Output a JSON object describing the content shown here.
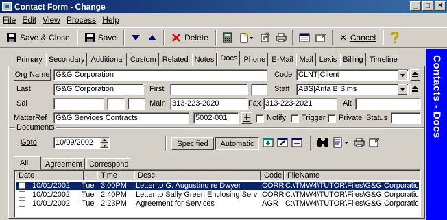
{
  "window": {
    "title": "Contact Form - Change"
  },
  "menu": [
    "File",
    "Edit",
    "View",
    "Process",
    "Help"
  ],
  "toolbar": {
    "save_close": "Save & Close",
    "save": "Save",
    "delete": "Delete",
    "cancel": "Cancel"
  },
  "tabs": [
    "Primary",
    "Secondary",
    "Additional",
    "Custom",
    "Related",
    "Notes",
    "Docs",
    "Phone",
    "E-Mail",
    "Mail",
    "Lexis",
    "Billing",
    "Timeline"
  ],
  "active_tab": "Docs",
  "banner": "Contacts - Docs",
  "form": {
    "org_name_label": "Org Name",
    "org_name": "G&G Corporation",
    "code_label": "Code",
    "code": "CLNT|Client",
    "last_label": "Last",
    "last": "G&G Corporation",
    "first_label": "First",
    "first": "",
    "staff_label": "Staff",
    "staff": "ABS|Arita B Sims",
    "sal_label": "Sal",
    "main_label": "Main",
    "main": "313-223-2020",
    "fax_label": "Fax",
    "fax": "313-223-2021",
    "alt_label": "Alt",
    "alt": "",
    "matterref_label": "MatterRef",
    "matterref": "G&G Services Contracts",
    "matter_no": "5002-001",
    "notify_label": "Notify",
    "trigger_label": "Trigger",
    "private_label": "Private",
    "status_label": "Status",
    "status": ""
  },
  "documents": {
    "group_label": "Documents",
    "goto_label": "Goto",
    "goto_date": "10/09/2002",
    "specified_label": "Specified",
    "automatic_label": "Automatic",
    "subtabs": [
      "All",
      "Agreement",
      "Correspond"
    ],
    "columns": [
      "Date",
      "Time",
      "Desc",
      "Code",
      "FileName"
    ],
    "rows": [
      {
        "date": "10/01/2002",
        "day": "Tue",
        "time": "3:00PM",
        "desc": "Letter to G. Augustino re Dwyer",
        "code": "CORR",
        "file": "C:\\TMW4\\TUTOR\\Files\\G&G Corporatio"
      },
      {
        "date": "10/01/2002",
        "day": "Tue",
        "time": "2:40PM",
        "desc": "Letter to Sally Green Enclosing Servi",
        "code": "CORR",
        "file": "C:\\TMW4\\TUTOR\\Files\\G&G Corporatio"
      },
      {
        "date": "10/01/2002",
        "day": "Tue",
        "time": "2:23PM",
        "desc": "Agreement for Services",
        "code": "AGR",
        "file": "C:\\TMW4\\TUTOR\\Files\\G&G Corporatio"
      }
    ]
  }
}
